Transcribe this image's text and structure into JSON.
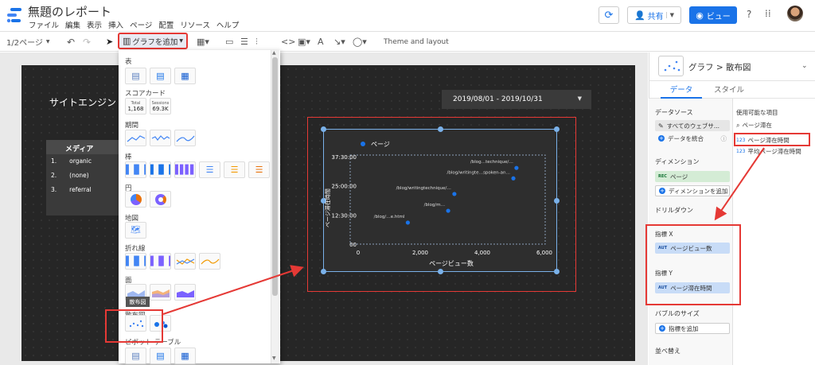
{
  "header": {
    "title": "無題のレポート",
    "menus": [
      "ファイル",
      "編集",
      "表示",
      "挿入",
      "ページ",
      "配置",
      "リソース",
      "ヘルプ"
    ],
    "share_label": "共有",
    "view_label": "ビュー"
  },
  "toolbar": {
    "page_indicator": "1/2ページ",
    "add_chart_label": "グラフを追加",
    "theme_label": "Theme and layout"
  },
  "dropdown": {
    "sections": {
      "table": "表",
      "scorecard": "スコアカード",
      "timeseries": "期間",
      "bar": "棒",
      "pie": "円",
      "geo": "地図",
      "line": "折れ線",
      "area": "面",
      "scatter": "散布図",
      "pivot": "ピボット テーブル"
    },
    "scorecard_items": [
      {
        "label": "Total",
        "value": "1,168"
      },
      {
        "label": "Sessions",
        "value": "69.3K"
      }
    ],
    "tooltip": "散布図"
  },
  "report": {
    "title": "サイトエンジン",
    "date_range": "2019/08/01 - 2019/10/31",
    "medium_table": {
      "header": "メディア",
      "rows": [
        {
          "index": "1.",
          "name": "organic"
        },
        {
          "index": "2.",
          "name": "(none)"
        },
        {
          "index": "3.",
          "name": "referral"
        }
      ]
    }
  },
  "chart": {
    "legend": "ページ"
  },
  "chart_data": {
    "type": "scatter",
    "series": [
      {
        "name": "ページ",
        "points": [
          {
            "x": 1600,
            "y": 0.3847,
            "label": "/blog/…e.html"
          },
          {
            "x": 2900,
            "y": 0.5958,
            "label": "/blog/m…"
          },
          {
            "x": 3100,
            "y": 0.8958,
            "label": "/blog/writingtechnique/…"
          },
          {
            "x": 5100,
            "y": 1.3611,
            "label": "/blog…technique/…"
          },
          {
            "x": 5000,
            "y": 1.175,
            "label": "/blog/writingte…spoken-an…"
          }
        ]
      }
    ],
    "xlabel": "ページビュー数",
    "ylabel": "ページ滞在時間",
    "x_ticks": [
      "0",
      "2,000",
      "4,000",
      "6,000"
    ],
    "y_ticks": [
      "00",
      "12:30:00",
      "25:00:00",
      "37:30:00"
    ],
    "xlim": [
      0,
      6000
    ],
    "ylim": [
      0,
      1.5625
    ],
    "grid": false,
    "legend_position": "top-left",
    "colors": {
      "point": "#1a73e8"
    }
  },
  "panel": {
    "breadcrumb": "グラフ > 散布図",
    "tabs": [
      "データ",
      "スタイル"
    ],
    "data_source": {
      "label": "データソース",
      "value": "すべてのウェブサ...",
      "blend": "データを統合"
    },
    "dimension": {
      "label": "ディメンション",
      "chip": "ページ",
      "add": "ディメンションを追加"
    },
    "drilldown": "ドリルダウン",
    "metric_x": {
      "label": "指標 X",
      "chip": "ページビュー数",
      "tag": "AUT"
    },
    "metric_y": {
      "label": "指標 Y",
      "chip": "ページ滞在時間",
      "tag": "AUT"
    },
    "bubble_size": {
      "label": "バブルのサイズ",
      "add": "指標を追加"
    },
    "sort": "並べ替え",
    "available_fields": {
      "label": "使用可能な項目",
      "search": "ページ滞在",
      "items": [
        {
          "tag": "123",
          "name": "ページ滞在時間"
        },
        {
          "tag": "123",
          "name": "平均ページ滞在時間"
        }
      ]
    },
    "rec_tag": "REC"
  }
}
